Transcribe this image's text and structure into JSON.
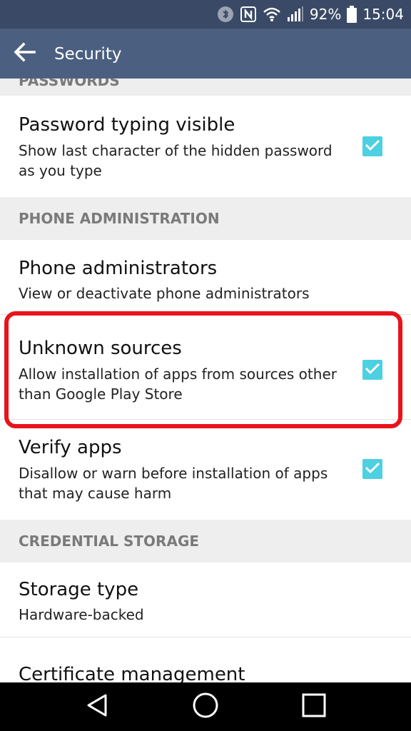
{
  "status_bar": {
    "battery_percent": "92%",
    "time": "15:04",
    "icons": [
      "bluetooth-icon",
      "nfc-icon",
      "wifi-icon",
      "signal-icon",
      "battery-icon"
    ]
  },
  "app_bar": {
    "title": "Security",
    "back_icon": "arrow-back-icon"
  },
  "sections": {
    "passwords_header_partial": "PASSWORDS",
    "phone_admin_header": "PHONE ADMINISTRATION",
    "credential_storage_header": "CREDENTIAL STORAGE"
  },
  "items": {
    "password_visible": {
      "title": "Password typing visible",
      "summary": "Show last character of the hidden password as you type",
      "checked": true
    },
    "phone_admins": {
      "title": "Phone administrators",
      "summary": "View or deactivate phone administrators"
    },
    "unknown_sources": {
      "title": "Unknown sources",
      "summary": "Allow installation of apps from sources other than Google Play Store",
      "checked": true
    },
    "verify_apps": {
      "title": "Verify apps",
      "summary": "Disallow or warn before installation of apps that may cause harm",
      "checked": true
    },
    "storage_type": {
      "title": "Storage type",
      "summary": "Hardware-backed"
    },
    "cert_management": {
      "title": "Certificate management"
    }
  },
  "colors": {
    "status_bar": "#3a4a66",
    "app_bar": "#4b5f80",
    "checkbox": "#4dd0e1",
    "highlight": "#e8131b"
  },
  "nav_bar": {
    "icons": [
      "back-triangle-icon",
      "home-circle-icon",
      "recents-square-icon"
    ]
  }
}
